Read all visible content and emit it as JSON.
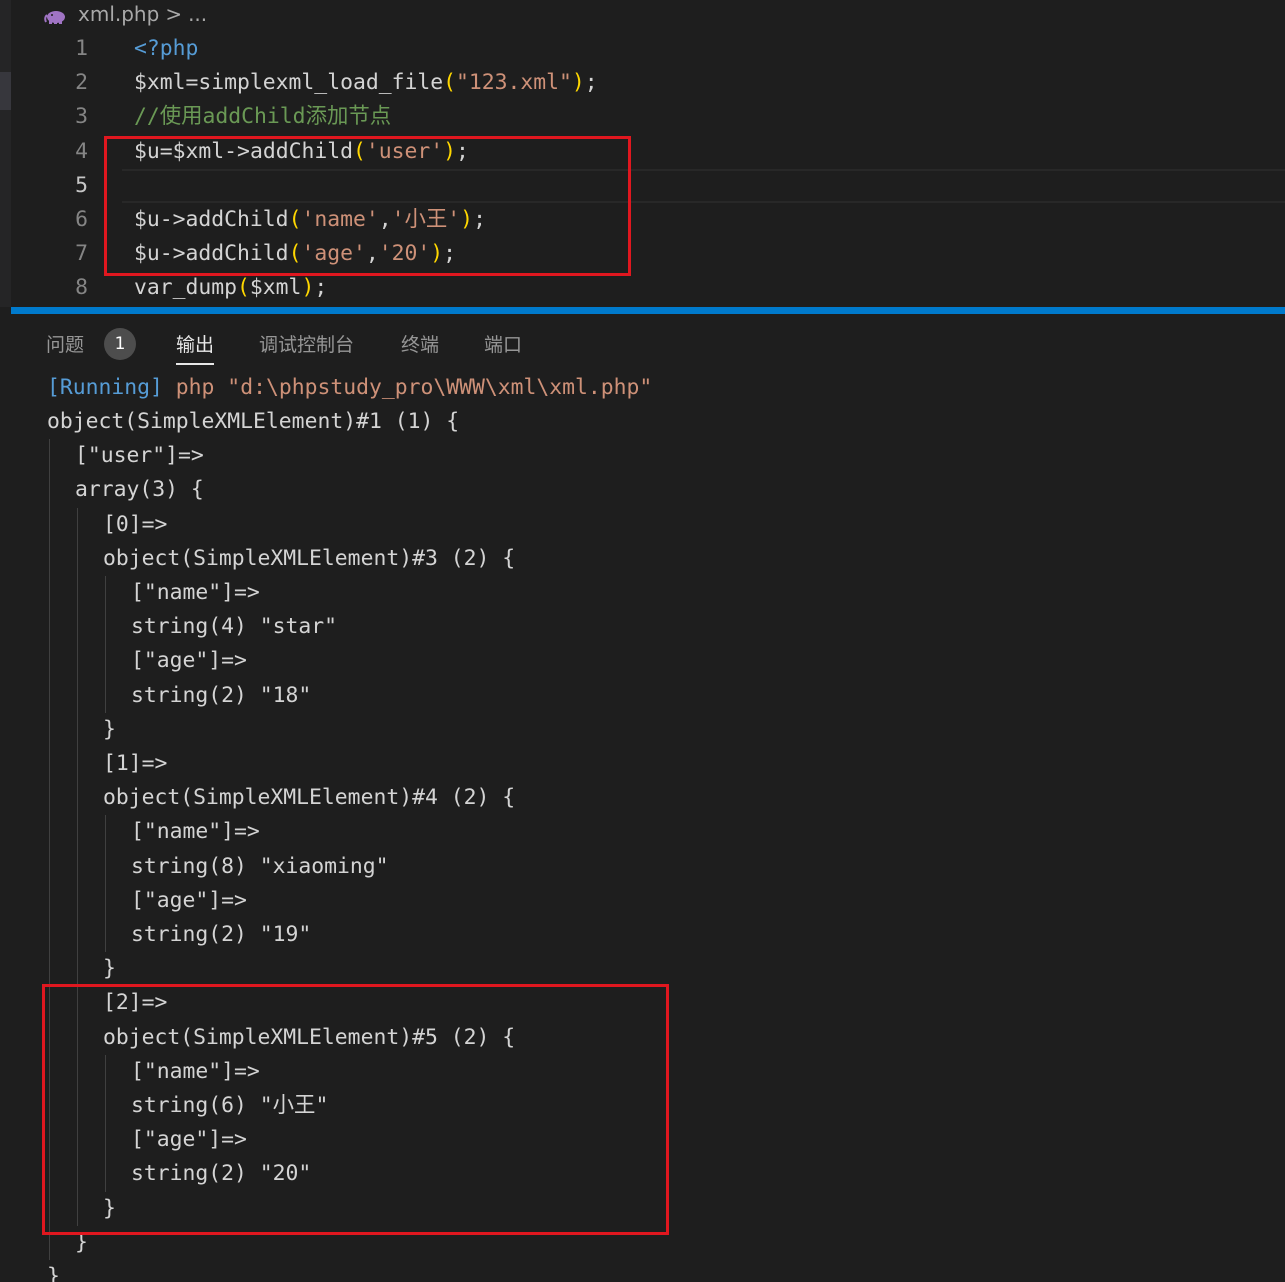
{
  "breadcrumb": {
    "file": "xml.php",
    "separator": ">",
    "more": "..."
  },
  "editor": {
    "lines": [
      {
        "number": "1",
        "segments": [
          {
            "t": "<?php",
            "k": "tag"
          }
        ]
      },
      {
        "number": "2",
        "segments": [
          {
            "t": "$xml",
            "k": "var"
          },
          {
            "t": "=",
            "k": "pl"
          },
          {
            "t": "simplexml_load_file",
            "k": "fn"
          },
          {
            "t": "(",
            "k": "par"
          },
          {
            "t": "\"123.xml\"",
            "k": "str"
          },
          {
            "t": ")",
            "k": "par"
          },
          {
            "t": ";",
            "k": "pl"
          }
        ]
      },
      {
        "number": "3",
        "segments": [
          {
            "t": "//使用addChild添加节点",
            "k": "cmt"
          }
        ]
      },
      {
        "number": "4",
        "segments": [
          {
            "t": "$u",
            "k": "var"
          },
          {
            "t": "=",
            "k": "pl"
          },
          {
            "t": "$xml",
            "k": "var"
          },
          {
            "t": "->",
            "k": "pl"
          },
          {
            "t": "addChild",
            "k": "fn"
          },
          {
            "t": "(",
            "k": "par"
          },
          {
            "t": "'user'",
            "k": "str"
          },
          {
            "t": ")",
            "k": "par"
          },
          {
            "t": ";",
            "k": "pl"
          }
        ]
      },
      {
        "number": "5",
        "segments": []
      },
      {
        "number": "6",
        "segments": [
          {
            "t": "$u",
            "k": "var"
          },
          {
            "t": "->",
            "k": "pl"
          },
          {
            "t": "addChild",
            "k": "fn"
          },
          {
            "t": "(",
            "k": "par"
          },
          {
            "t": "'name'",
            "k": "str"
          },
          {
            "t": ",",
            "k": "pl"
          },
          {
            "t": "'小王'",
            "k": "str"
          },
          {
            "t": ")",
            "k": "par"
          },
          {
            "t": ";",
            "k": "pl"
          }
        ]
      },
      {
        "number": "7",
        "segments": [
          {
            "t": "$u",
            "k": "var"
          },
          {
            "t": "->",
            "k": "pl"
          },
          {
            "t": "addChild",
            "k": "fn"
          },
          {
            "t": "(",
            "k": "par"
          },
          {
            "t": "'age'",
            "k": "str"
          },
          {
            "t": ",",
            "k": "pl"
          },
          {
            "t": "'20'",
            "k": "str"
          },
          {
            "t": ")",
            "k": "par"
          },
          {
            "t": ";",
            "k": "pl"
          }
        ]
      },
      {
        "number": "8",
        "segments": [
          {
            "t": "var_dump",
            "k": "fn"
          },
          {
            "t": "(",
            "k": "par"
          },
          {
            "t": "$xml",
            "k": "var"
          },
          {
            "t": ")",
            "k": "par"
          },
          {
            "t": ";",
            "k": "pl"
          }
        ]
      }
    ]
  },
  "panel": {
    "tabs": {
      "problems": "问题",
      "problems_count": "1",
      "output": "输出",
      "debug_console": "调试控制台",
      "terminal": "终端",
      "ports": "端口"
    },
    "output": {
      "running_label": "[Running]",
      "command": "php \"d:\\phpstudy_pro\\WWW\\xml\\xml.php\"",
      "lines": [
        {
          "indent": 0,
          "text": "object(SimpleXMLElement)#1 (1) {"
        },
        {
          "indent": 1,
          "text": "[\"user\"]=>"
        },
        {
          "indent": 1,
          "text": "array(3) {"
        },
        {
          "indent": 2,
          "text": "[0]=>"
        },
        {
          "indent": 2,
          "text": "object(SimpleXMLElement)#3 (2) {"
        },
        {
          "indent": 3,
          "text": "[\"name\"]=>"
        },
        {
          "indent": 3,
          "text": "string(4) \"star\""
        },
        {
          "indent": 3,
          "text": "[\"age\"]=>"
        },
        {
          "indent": 3,
          "text": "string(2) \"18\""
        },
        {
          "indent": 2,
          "text": "}"
        },
        {
          "indent": 2,
          "text": "[1]=>"
        },
        {
          "indent": 2,
          "text": "object(SimpleXMLElement)#4 (2) {"
        },
        {
          "indent": 3,
          "text": "[\"name\"]=>"
        },
        {
          "indent": 3,
          "text": "string(8) \"xiaoming\""
        },
        {
          "indent": 3,
          "text": "[\"age\"]=>"
        },
        {
          "indent": 3,
          "text": "string(2) \"19\""
        },
        {
          "indent": 2,
          "text": "}"
        },
        {
          "indent": 2,
          "text": "[2]=>"
        },
        {
          "indent": 2,
          "text": "object(SimpleXMLElement)#5 (2) {"
        },
        {
          "indent": 3,
          "text": "[\"name\"]=>"
        },
        {
          "indent": 3,
          "text": "string(6) \"小王\""
        },
        {
          "indent": 3,
          "text": "[\"age\"]=>"
        },
        {
          "indent": 3,
          "text": "string(2) \"20\""
        },
        {
          "indent": 2,
          "text": "}"
        },
        {
          "indent": 1,
          "text": "}"
        },
        {
          "indent": 0,
          "text": "}"
        }
      ]
    }
  },
  "colors": {
    "background": "#1e1e1e",
    "accent": "#007acc",
    "highlight_box": "#e0171f"
  }
}
